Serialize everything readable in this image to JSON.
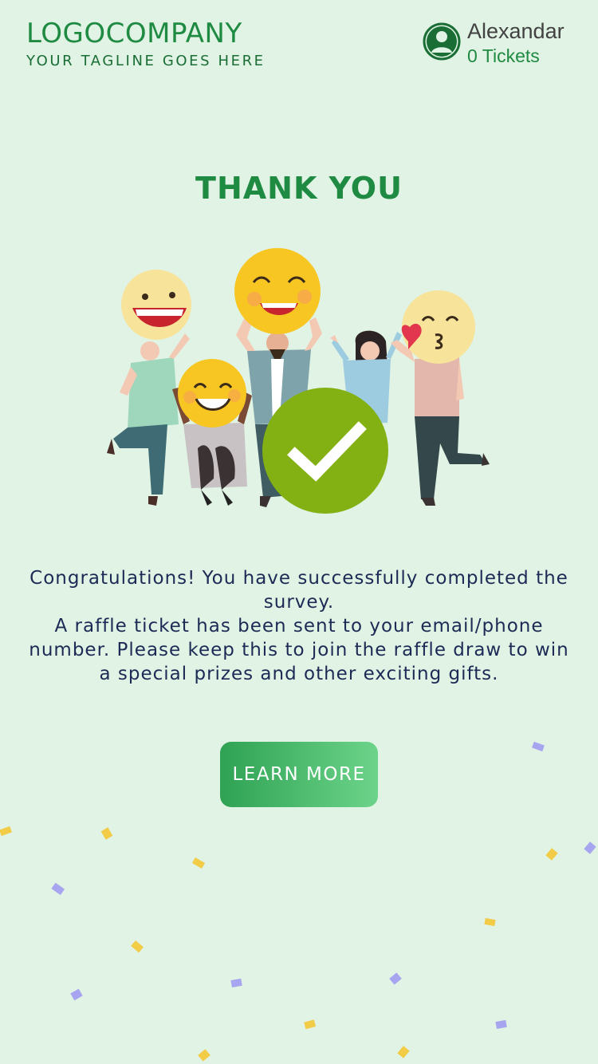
{
  "header": {
    "logo": "LOGOCOMPANY",
    "tagline": "YOUR TAGLINE GOES HERE",
    "user": {
      "name": "Alexandar",
      "tickets": "0 Tickets"
    }
  },
  "main": {
    "title": "THANK YOU",
    "message": [
      "Congratulations! You have successfully completed the survey.",
      "A raffle ticket has been sent to your email/phone number. Please keep this to join the raffle draw to win a special prizes and other exciting gifts."
    ],
    "cta_label": "LEARN MORE"
  },
  "colors": {
    "background": "#e0f3e4",
    "brand_green": "#1f8a41",
    "text_dark": "#1d2a55",
    "button_start": "#2fa253",
    "button_end": "#6cd48a",
    "check_badge": "#83b113"
  },
  "icons": {
    "avatar": "user-silhouette-icon",
    "badge": "checkmark-icon",
    "confetti": "confetti-decoration"
  }
}
